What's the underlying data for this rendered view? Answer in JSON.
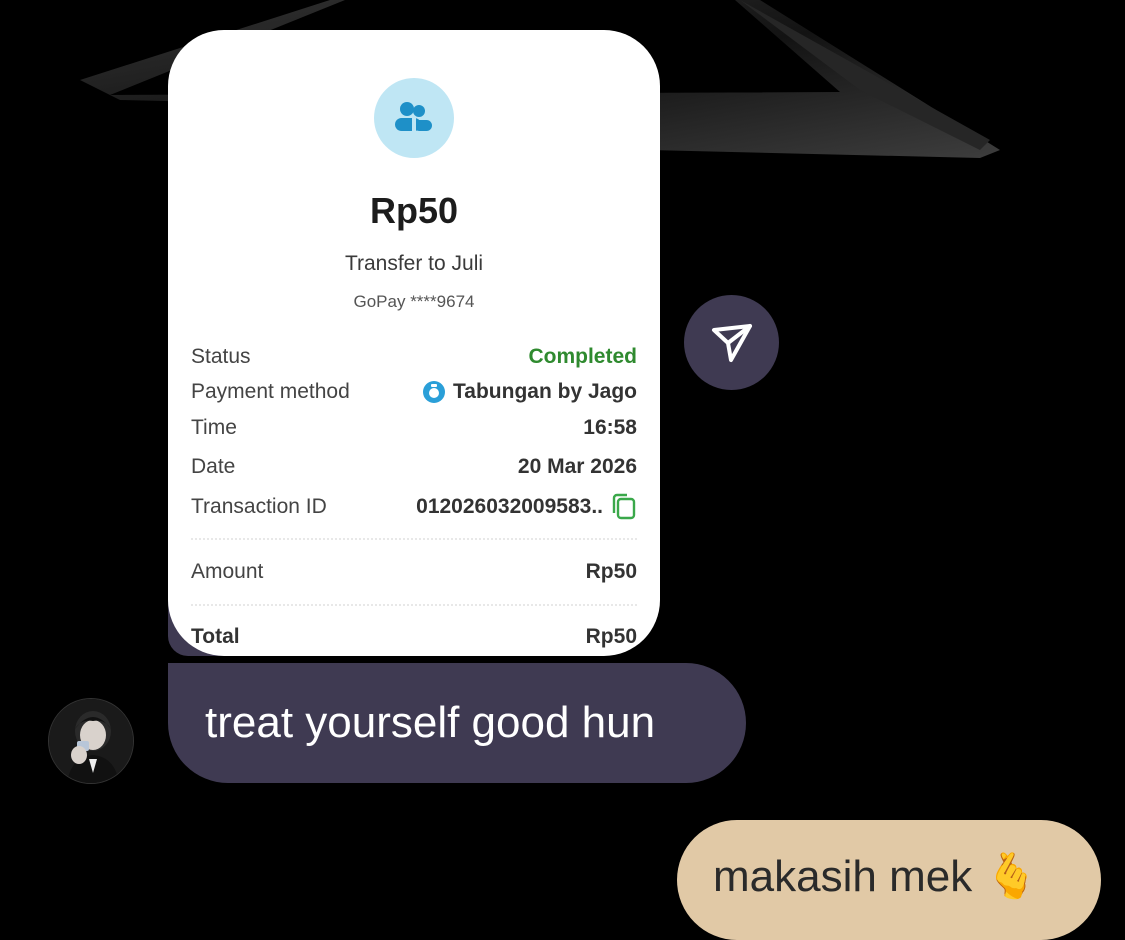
{
  "receipt": {
    "amount": "Rp50",
    "title": "Transfer to Juli",
    "account": "GoPay ****9674",
    "rows": [
      {
        "label": "Status",
        "value": "Completed"
      },
      {
        "label": "Payment method",
        "value": "Tabungan by Jago"
      },
      {
        "label": "Time",
        "value": "16:58"
      },
      {
        "label": "Date",
        "value": "20 Mar 2026"
      },
      {
        "label": "Transaction ID",
        "value": "012026032009583.."
      }
    ],
    "amount_row": {
      "label": "Amount",
      "value": "Rp50"
    },
    "total_row": {
      "label": "Total",
      "value": "Rp50"
    },
    "status_color": "#2f8a2f",
    "icon": "people-icon"
  },
  "messages": {
    "received": "treat yourself good hun",
    "sent": "makasih mek 🫰"
  },
  "colors": {
    "bubble_in": "#3f3a52",
    "bubble_out": "#e1c9a6",
    "background": "#000000"
  }
}
